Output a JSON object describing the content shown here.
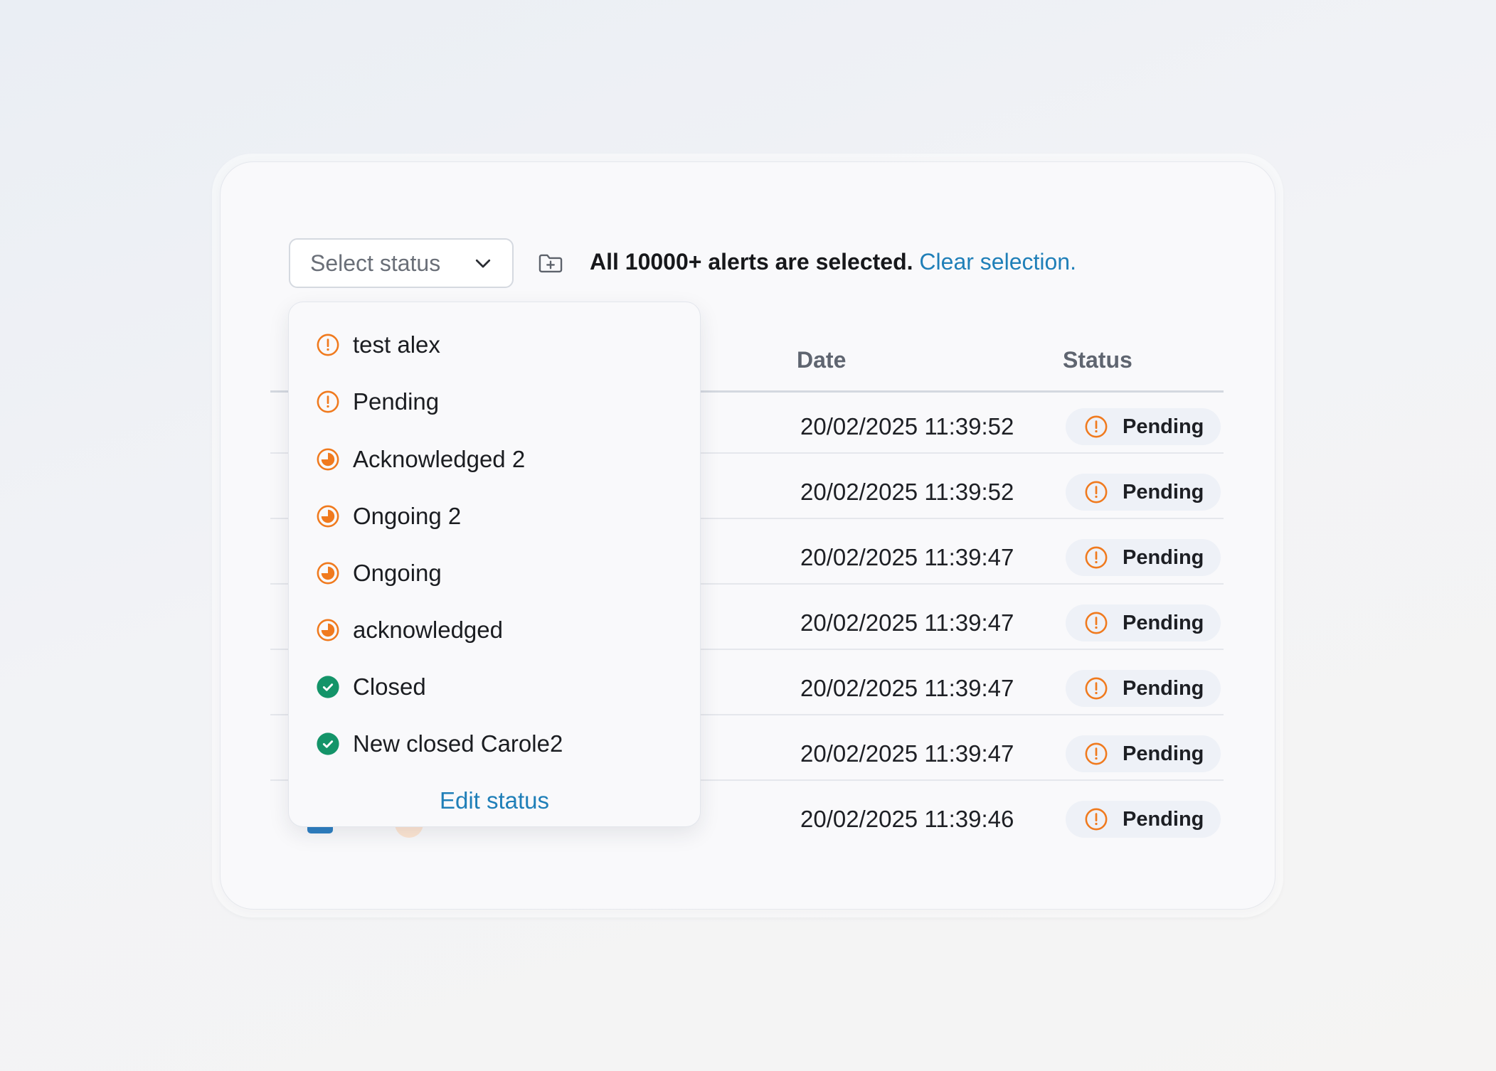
{
  "toolbar": {
    "select_placeholder": "Select status",
    "selection_message": "All 10000+ alerts are selected.",
    "clear_selection": "Clear selection."
  },
  "table": {
    "columns": [
      "Date",
      "Status"
    ],
    "rows": [
      {
        "date": "20/02/2025 11:39:52",
        "status": "Pending"
      },
      {
        "date": "20/02/2025 11:39:52",
        "status": "Pending"
      },
      {
        "date": "20/02/2025 11:39:47",
        "status": "Pending"
      },
      {
        "date": "20/02/2025 11:39:47",
        "status": "Pending"
      },
      {
        "date": "20/02/2025 11:39:47",
        "status": "Pending"
      },
      {
        "date": "20/02/2025 11:39:47",
        "status": "Pending"
      },
      {
        "date": "20/02/2025 11:39:46",
        "status": "Pending"
      }
    ]
  },
  "dropdown": {
    "items": [
      {
        "label": "test alex",
        "icon": "alert-circle-icon"
      },
      {
        "label": "Pending",
        "icon": "alert-circle-icon"
      },
      {
        "label": "Acknowledged 2",
        "icon": "progress-icon"
      },
      {
        "label": "Ongoing 2",
        "icon": "progress-icon"
      },
      {
        "label": "Ongoing",
        "icon": "progress-icon"
      },
      {
        "label": "acknowledged",
        "icon": "progress-icon"
      },
      {
        "label": "Closed",
        "icon": "check-circle-icon"
      },
      {
        "label": "New closed Carole2",
        "icon": "check-circle-icon"
      }
    ],
    "edit_label": "Edit status"
  },
  "colors": {
    "accent": "#1f7fb8",
    "pending_orange": "#f07a1e",
    "closed_green": "#149469",
    "badge_bg": "#eef1f7"
  }
}
